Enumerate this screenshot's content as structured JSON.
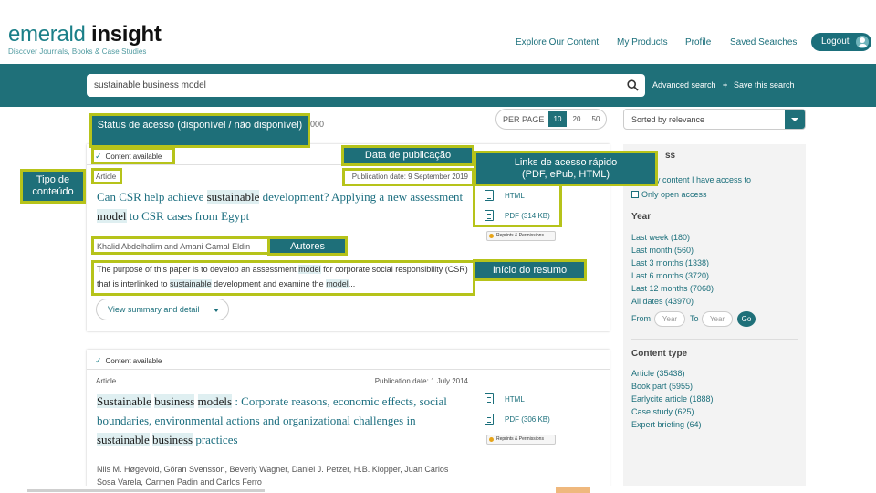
{
  "header": {
    "logo_emerald": "emerald",
    "logo_insight": "insight",
    "tagline": "Discover Journals, Books & Case Studies",
    "nav": [
      "Explore Our Content",
      "My Products",
      "Profile",
      "Saved Searches"
    ],
    "logout": "Logout"
  },
  "search": {
    "query": "sustainable business model",
    "advanced": "Advanced search",
    "save": "Save this search"
  },
  "results": {
    "count_fragment": "000",
    "per_page_label": "PER PAGE",
    "per_page_options": [
      "10",
      "20",
      "50"
    ],
    "per_page_selected": "10",
    "sort_label": "Sorted by relevance"
  },
  "result1": {
    "availability": "Content available",
    "content_type": "Article",
    "pub_date": "Publication date: 9 September 2019",
    "title_parts": [
      "Can CSR help achieve ",
      "sustainable",
      " development? Applying a new assessment ",
      "model",
      " to CSR cases from Egypt"
    ],
    "authors": "Khalid Abdelhalim and Amani Gamal Eldin",
    "abstract_parts": [
      "The purpose of this paper is to develop an assessment ",
      "model",
      " for corporate social responsibility (CSR) that is interlinked to ",
      "sustainable",
      " development and examine the ",
      "model",
      "..."
    ],
    "summary_button": "View summary and detail",
    "html_link": "HTML",
    "pdf_link": "PDF (314 KB)",
    "reprints": "Reprints & Permissions"
  },
  "result2": {
    "availability": "Content available",
    "content_type": "Article",
    "pub_date": "Publication date: 1 July 2014",
    "title_parts": [
      "Sustainable",
      " ",
      "business",
      " ",
      "models",
      " : Corporate reasons, economic effects, social boundaries, environmental actions and organizational challenges in ",
      "sustainable",
      " ",
      "business",
      " practices"
    ],
    "authors": "Nils M. Høgevold, Göran Svensson, Beverly Wagner, Daniel J. Petzer, H.B. Klopper, Juan Carlos Sosa Varela, Carmen Padin and Carlos Ferro",
    "html_link": "HTML",
    "pdf_link": "PDF (306 KB)",
    "reprints": "Reprints & Permissions"
  },
  "sidebar": {
    "access_head_fragment": "ss",
    "access_options": [
      "Only content I have access to",
      "Only open access"
    ],
    "year_head": "Year",
    "year_links": [
      "Last week (180)",
      "Last month (560)",
      "Last 3 months (1338)",
      "Last 6 months (3720)",
      "Last 12 months (7068)",
      "All dates (43970)"
    ],
    "from_label": "From",
    "from_placeholder": "Year",
    "to_label": "To",
    "to_placeholder": "Year",
    "go": "Go",
    "content_type_head": "Content type",
    "content_type_links": [
      "Article (35438)",
      "Book part (5955)",
      "Earlycite article (1888)",
      "Case study (625)",
      "Expert briefing (64)"
    ]
  },
  "annotations": {
    "status": "Status de acesso (disponível / não disponível)",
    "pubdate": "Data de publicação",
    "type": "Tipo de conteúdo",
    "links": "Links de acesso rápido (PDF, ePub, HTML)",
    "authors": "Autores",
    "abstract": "Início do resumo"
  },
  "colors": {
    "teal": "#1f7079",
    "annotation_border": "#b6c31a",
    "highlight": "#dfeff1"
  }
}
